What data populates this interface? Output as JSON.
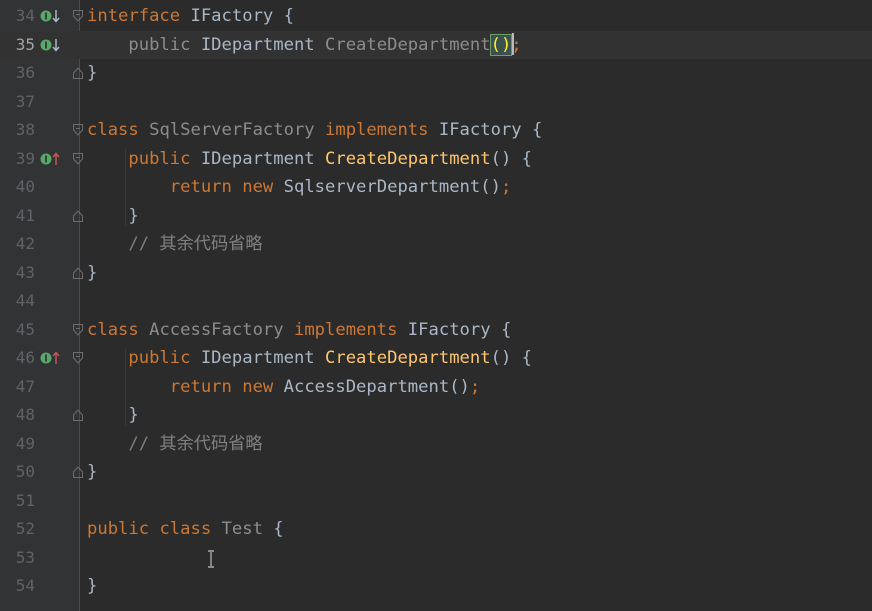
{
  "editor": {
    "lines": [
      {
        "num": "34",
        "tokens": [
          {
            "t": "interface ",
            "c": "kw"
          },
          {
            "t": "IFactory ",
            "c": "type"
          },
          {
            "t": "{",
            "c": "type"
          }
        ]
      },
      {
        "num": "35",
        "tokens": [
          {
            "t": "    public ",
            "c": "gray"
          },
          {
            "t": "IDepartment ",
            "c": "type"
          },
          {
            "t": "CreateDepartment",
            "c": "gray"
          },
          {
            "t": "()",
            "c": "bracket-hl"
          },
          {
            "t": ";",
            "c": "semi"
          }
        ]
      },
      {
        "num": "36",
        "tokens": [
          {
            "t": "}",
            "c": "type"
          }
        ]
      },
      {
        "num": "37",
        "tokens": []
      },
      {
        "num": "38",
        "tokens": [
          {
            "t": "class ",
            "c": "kw"
          },
          {
            "t": "SqlServerFactory ",
            "c": "gray"
          },
          {
            "t": "implements ",
            "c": "kw"
          },
          {
            "t": "IFactory ",
            "c": "type"
          },
          {
            "t": "{",
            "c": "type"
          }
        ]
      },
      {
        "num": "39",
        "tokens": [
          {
            "t": "    public ",
            "c": "kw"
          },
          {
            "t": "IDepartment ",
            "c": "type"
          },
          {
            "t": "CreateDepartment",
            "c": "fn"
          },
          {
            "t": "() {",
            "c": "type"
          }
        ]
      },
      {
        "num": "40",
        "tokens": [
          {
            "t": "        return ",
            "c": "kw"
          },
          {
            "t": "new ",
            "c": "kw"
          },
          {
            "t": "SqlserverDepartment()",
            "c": "type"
          },
          {
            "t": ";",
            "c": "semi"
          }
        ]
      },
      {
        "num": "41",
        "tokens": [
          {
            "t": "    }",
            "c": "type"
          }
        ]
      },
      {
        "num": "42",
        "tokens": [
          {
            "t": "    // 其余代码省略",
            "c": "cmt"
          }
        ]
      },
      {
        "num": "43",
        "tokens": [
          {
            "t": "}",
            "c": "type"
          }
        ]
      },
      {
        "num": "44",
        "tokens": []
      },
      {
        "num": "45",
        "tokens": [
          {
            "t": "class ",
            "c": "kw"
          },
          {
            "t": "AccessFactory ",
            "c": "gray"
          },
          {
            "t": "implements ",
            "c": "kw"
          },
          {
            "t": "IFactory ",
            "c": "type"
          },
          {
            "t": "{",
            "c": "type"
          }
        ]
      },
      {
        "num": "46",
        "tokens": [
          {
            "t": "    public ",
            "c": "kw"
          },
          {
            "t": "IDepartment ",
            "c": "type"
          },
          {
            "t": "CreateDepartment",
            "c": "fn"
          },
          {
            "t": "() {",
            "c": "type"
          }
        ]
      },
      {
        "num": "47",
        "tokens": [
          {
            "t": "        return ",
            "c": "kw"
          },
          {
            "t": "new ",
            "c": "kw"
          },
          {
            "t": "AccessDepartment()",
            "c": "type"
          },
          {
            "t": ";",
            "c": "semi"
          }
        ]
      },
      {
        "num": "48",
        "tokens": [
          {
            "t": "    }",
            "c": "type"
          }
        ]
      },
      {
        "num": "49",
        "tokens": [
          {
            "t": "    // 其余代码省略",
            "c": "cmt"
          }
        ]
      },
      {
        "num": "50",
        "tokens": [
          {
            "t": "}",
            "c": "type"
          }
        ]
      },
      {
        "num": "51",
        "tokens": []
      },
      {
        "num": "52",
        "tokens": [
          {
            "t": "public ",
            "c": "kw"
          },
          {
            "t": "class ",
            "c": "kw"
          },
          {
            "t": "Test ",
            "c": "gray"
          },
          {
            "t": "{",
            "c": "type"
          }
        ]
      },
      {
        "num": "53",
        "tokens": []
      },
      {
        "num": "54",
        "tokens": [
          {
            "t": "}",
            "c": "type"
          }
        ]
      }
    ],
    "current_line": "35",
    "gutter_icons": {
      "34": "implemented-down-icon",
      "35": "implemented-down-icon",
      "39": "implements-up-icon",
      "46": "implements-up-icon"
    },
    "fold_markers": {
      "34": "open",
      "36": "close",
      "38": "open",
      "39": "open",
      "41": "close",
      "43": "close",
      "45": "open",
      "46": "open",
      "48": "close",
      "50": "close"
    },
    "colors": {
      "background": "#2b2b2b",
      "keyword": "#cc7832",
      "method": "#ffc66d",
      "text": "#a9b7c6",
      "comment": "#808080",
      "gutter_icon": "#59a869",
      "up_arrow": "#c75450"
    }
  }
}
